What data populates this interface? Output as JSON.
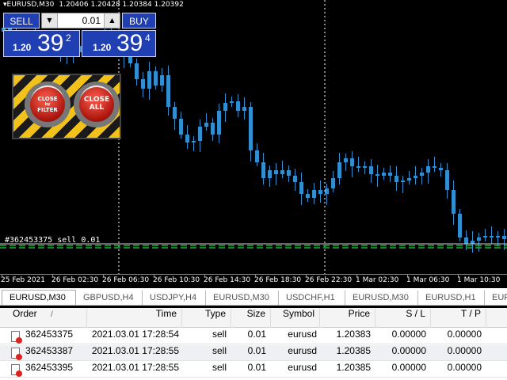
{
  "chart": {
    "symbol_period": "EURUSD,M30",
    "ohlc": "1.20406 1.20428 1.20384 1.20392",
    "order_line_label": "#362453375 sell 0.01",
    "colors": {
      "background": "#000000",
      "candle": "#2f8fd0",
      "order_line": "#1fae3a",
      "grid": "#ffffff"
    },
    "time_labels": [
      "25 Feb 2021",
      "26 Feb 02:30",
      "26 Feb 06:30",
      "26 Feb 10:30",
      "26 Feb 14:30",
      "26 Feb 18:30",
      "26 Feb 22:30",
      "1 Mar 02:30",
      "1 Mar 06:30",
      "1 Mar 10:30"
    ]
  },
  "trade_panel": {
    "sell_label": "SELL",
    "buy_label": "BUY",
    "lot_value": "0.01",
    "down_arrow": "▼",
    "up_arrow": "▲",
    "sell_price": {
      "small": "1.20",
      "big": "39",
      "sup": "2"
    },
    "buy_price": {
      "small": "1.20",
      "big": "39",
      "sup": "4"
    }
  },
  "hazard_panel": {
    "close_filter": {
      "line1": "CLOSE",
      "line2": "by",
      "line3": "FILTER"
    },
    "close_all": {
      "line1": "CLOSE",
      "line2": "ALL"
    }
  },
  "tabs": [
    "EURUSD,M30",
    "GBPUSD,H4",
    "USDJPY,H4",
    "EURUSD,M30",
    "USDCHF,H1",
    "EURUSD,M30",
    "EURUSD,H1",
    "EUR"
  ],
  "orders": {
    "headers": {
      "order": "Order",
      "sort": "/",
      "time": "Time",
      "type": "Type",
      "size": "Size",
      "symbol": "Symbol",
      "price": "Price",
      "sl": "S / L",
      "tp": "T / P"
    },
    "rows": [
      {
        "order": "362453375",
        "time": "2021.03.01 17:28:54",
        "type": "sell",
        "size": "0.01",
        "symbol": "eurusd",
        "price": "1.20383",
        "sl": "0.00000",
        "tp": "0.00000"
      },
      {
        "order": "362453387",
        "time": "2021.03.01 17:28:55",
        "type": "sell",
        "size": "0.01",
        "symbol": "eurusd",
        "price": "1.20385",
        "sl": "0.00000",
        "tp": "0.00000"
      },
      {
        "order": "362453395",
        "time": "2021.03.01 17:28:55",
        "type": "sell",
        "size": "0.01",
        "symbol": "eurusd",
        "price": "1.20385",
        "sl": "0.00000",
        "tp": "0.00000"
      }
    ]
  }
}
